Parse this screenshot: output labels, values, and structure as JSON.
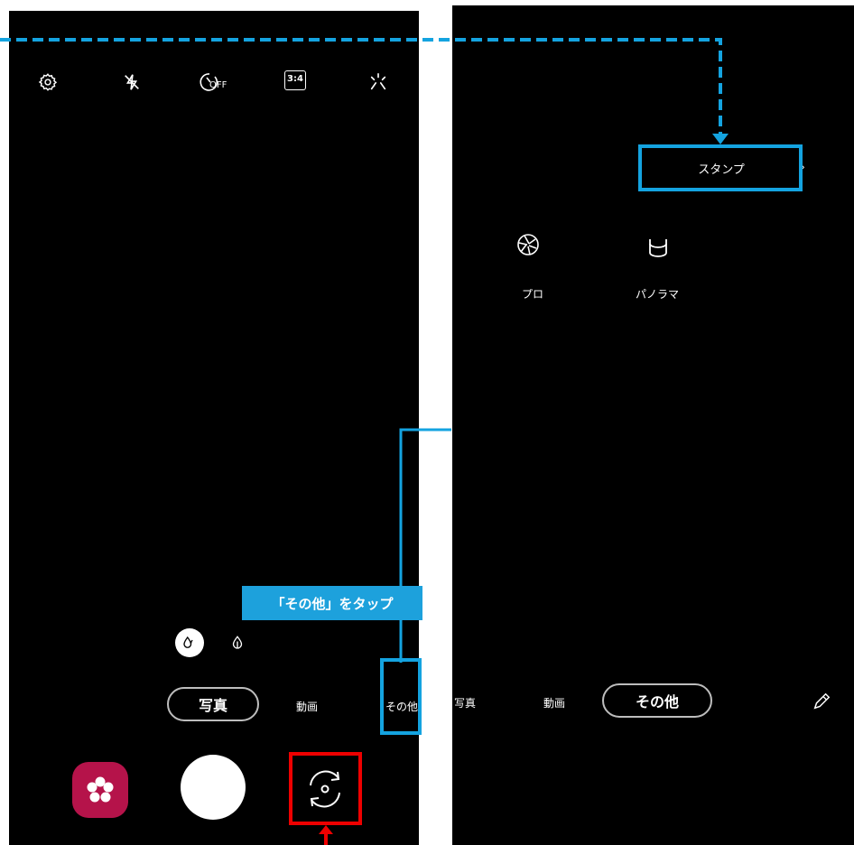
{
  "colors": {
    "annotation_blue": "#14a3e0",
    "annotation_red": "#ee0000",
    "app_icon": "#b5134a"
  },
  "left_screen": {
    "top_icons": [
      "settings-icon",
      "flash-off-icon",
      "timer-off-icon",
      "aspect-ratio-icon",
      "effects-icon"
    ],
    "timer_label": "OFF",
    "ratio_label": "3:4",
    "modes": {
      "photo": "写真",
      "video": "動画",
      "more": "その他"
    }
  },
  "right_screen": {
    "stamp_label": "スタンプ",
    "features": [
      {
        "label": "プロ",
        "icon": "aperture-icon"
      },
      {
        "label": "パノラマ",
        "icon": "panorama-icon"
      }
    ],
    "modes": {
      "photo": "写真",
      "video": "動画",
      "more": "その他"
    }
  },
  "annotation": {
    "callout": "「その他」をタップ"
  }
}
